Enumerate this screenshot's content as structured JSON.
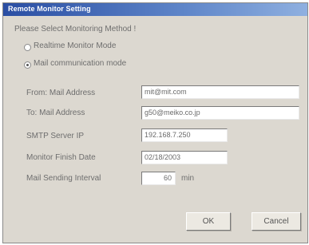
{
  "window": {
    "title": "Remote Monitor Setting"
  },
  "prompt": "Please Select Monitoring Method !",
  "modes": [
    {
      "label": "Realtime Monitor Mode",
      "selected": false
    },
    {
      "label": "Mail communication mode",
      "selected": true
    }
  ],
  "form": {
    "from_label": "From: Mail Address",
    "from_value": "mit@mit.com",
    "to_label": "To:  Mail Address",
    "to_value": "g50@meiko.co.jp",
    "smtp_label": "SMTP Server IP",
    "smtp_value": "192.168.7.250",
    "date_label": "Monitor Finish Date",
    "date_value": "02/18/2003",
    "interval_label": "Mail Sending Interval",
    "interval_value": "60",
    "interval_unit": "min"
  },
  "buttons": {
    "ok": "OK",
    "cancel": "Cancel"
  }
}
